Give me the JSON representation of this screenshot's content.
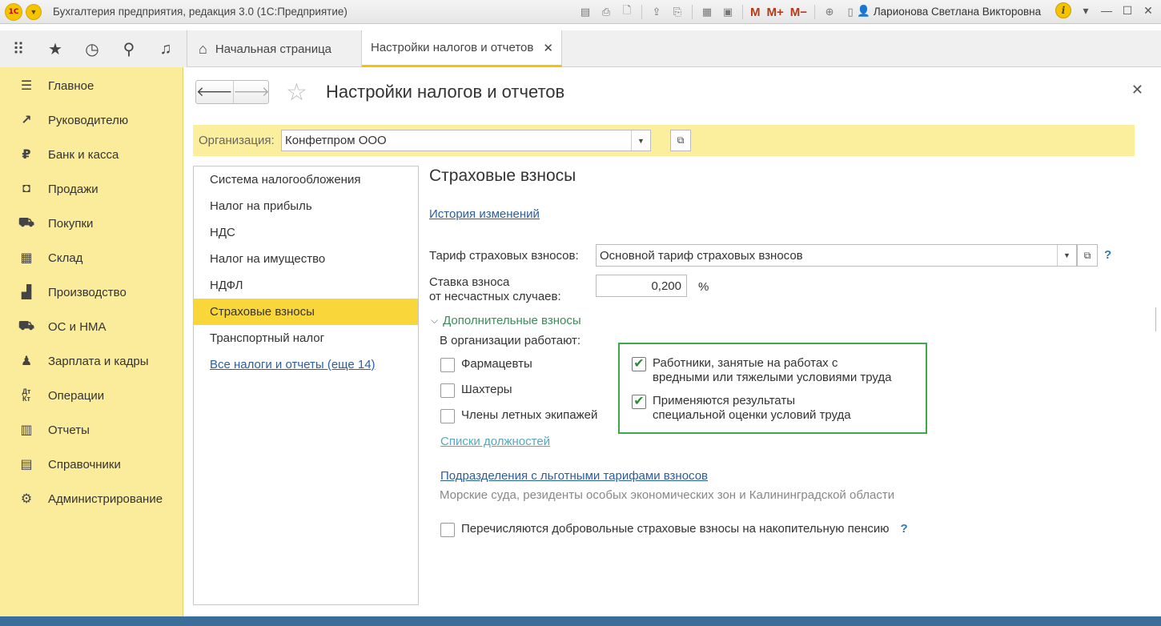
{
  "titlebar": {
    "logo_text": "1С",
    "app_title": "Бухгалтерия предприятия, редакция 3.0  (1С:Предприятие)",
    "m_labels": [
      "M",
      "M+",
      "M−"
    ],
    "user": "Ларионова Светлана Викторовна"
  },
  "topnav": {
    "tabs": [
      {
        "label": "Начальная страница"
      },
      {
        "label": "Настройки налогов и отчетов"
      }
    ]
  },
  "sidebar": {
    "items": [
      {
        "label": "Главное",
        "icon": "menu-icon"
      },
      {
        "label": "Руководителю",
        "icon": "trend-icon"
      },
      {
        "label": "Банк и касса",
        "icon": "ruble-icon"
      },
      {
        "label": "Продажи",
        "icon": "bag-icon"
      },
      {
        "label": "Покупки",
        "icon": "cart-icon"
      },
      {
        "label": "Склад",
        "icon": "warehouse-icon"
      },
      {
        "label": "Производство",
        "icon": "factory-icon"
      },
      {
        "label": "ОС и НМА",
        "icon": "truck-icon"
      },
      {
        "label": "Зарплата и кадры",
        "icon": "person-icon"
      },
      {
        "label": "Операции",
        "icon": "dt-kt-icon"
      },
      {
        "label": "Отчеты",
        "icon": "bar-chart-icon"
      },
      {
        "label": "Справочники",
        "icon": "books-icon"
      },
      {
        "label": "Администрирование",
        "icon": "gear-icon"
      }
    ]
  },
  "form": {
    "title": "Настройки налогов и отчетов",
    "org_label": "Организация:",
    "org_value": "Конфетпром ООО",
    "left_list": [
      {
        "label": "Система налогообложения"
      },
      {
        "label": "Налог на прибыль"
      },
      {
        "label": "НДС"
      },
      {
        "label": "Налог на имущество"
      },
      {
        "label": "НДФЛ"
      },
      {
        "label": "Страховые взносы"
      },
      {
        "label": "Транспортный налог"
      },
      {
        "label": "Все налоги и отчеты (еще 14)"
      }
    ],
    "section_title": "Страховые взносы",
    "history_link": "История изменений",
    "tariff_label": "Тариф страховых взносов:",
    "tariff_value": "Основной тариф страховых взносов",
    "rate_label_1": "Ставка взноса",
    "rate_label_2": "от несчастных случаев:",
    "rate_value": "0,200",
    "rate_unit": "%",
    "help_mark": "?",
    "additional_group": "Дополнительные взносы",
    "org_works_label": "В организации работают:",
    "left_checks": [
      {
        "label": "Фармацевты",
        "checked": false
      },
      {
        "label": "Шахтеры",
        "checked": false
      },
      {
        "label": "Члены летных экипажей",
        "checked": false
      }
    ],
    "right_checks": [
      {
        "line1": "Работники, занятые на работах с",
        "line2": "вредными или тяжелыми условиями труда",
        "checked": true
      },
      {
        "line1": "Применяются результаты",
        "line2": "специальной оценки условий труда",
        "checked": true
      }
    ],
    "positions_link": "Списки должностей",
    "divisions_link": "Подразделения с льготными тарифами взносов",
    "divisions_note": "Морские суда, резиденты особых экономических зон и Калининградской области",
    "voluntary_label": "Перечисляются добровольные страховые взносы на накопительную пенсию",
    "voluntary_checked": false,
    "colors": {
      "sidebar_bg": "#fbec9b",
      "active_item": "#f9d73a",
      "frame_green": "#3da84a",
      "link": "#2a5e9c"
    }
  }
}
